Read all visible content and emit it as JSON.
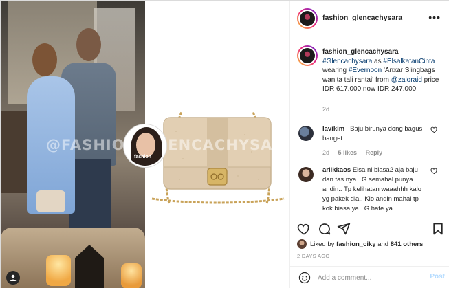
{
  "media": {
    "watermark": "@FASHION_GLENCACHYSARA",
    "profile_circle_label": "fashion"
  },
  "header": {
    "username": "fashion_glencachysara",
    "more_icon": "more-horizontal-icon",
    "more_glyph": "•••"
  },
  "caption": {
    "username": "fashion_glencachysara",
    "hashtag1": "#Glencachysara",
    "text_as": " as ",
    "hashtag2": "#ElsalkatanCinta",
    "text_wearing": " wearing ",
    "hashtag3": "#Evernoon",
    "text_body": " 'Anxar Slingbags wanita tali rantai' from ",
    "mention": "@zaloraid",
    "text_price": " price IDR 617.000 now IDR 247.000",
    "age": "2d"
  },
  "comments": [
    {
      "username": "lavikim_",
      "text": " Baju birunya dong bagus banget",
      "age": "2d",
      "likes": "5 likes",
      "reply": "Reply"
    },
    {
      "username": "arlikkaos",
      "text": " Elsa ni biasa2 aja baju dan tas nya.. G semahal punya andin.. Tp kelihatan waaahhh kalo yg pakek dia.. Klo andin mahal tp kok biasa ya.. G hate ya..."
    }
  ],
  "actions": {
    "liked_prefix": "Liked by ",
    "liked_user": "fashion_ciky",
    "liked_and": " and ",
    "liked_others": "841 others",
    "date": "2 DAYS AGO"
  },
  "add_comment": {
    "placeholder": "Add a comment...",
    "post_label": "Post"
  },
  "colors": {
    "link": "#00376b",
    "post_button": "#b3dbff",
    "meta": "#8e8e8e"
  }
}
